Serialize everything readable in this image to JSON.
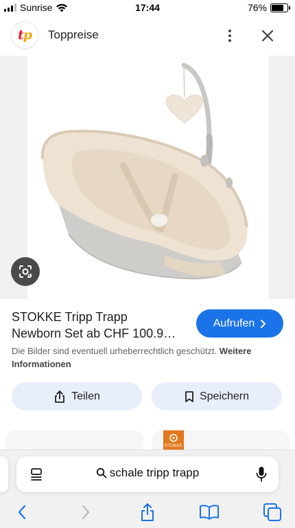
{
  "status_bar": {
    "carrier": "Sunrise",
    "time": "17:44",
    "battery_percent": "76%",
    "battery_level": 0.76
  },
  "header": {
    "logo_text_i": "t",
    "logo_text_p": "p",
    "site_name": "Toppreise"
  },
  "product": {
    "title_line1": "STOKKE Tripp Trapp",
    "title_line2": "Newborn Set ab CHF 100.9…",
    "visit_label": "Aufrufen",
    "copyright_text": "Die Bilder sind eventuell urheberrechtlich geschützt.",
    "copyright_link": "Weitere Informationen"
  },
  "actions": {
    "share_label": "Teilen",
    "save_label": "Speichern"
  },
  "cards": {
    "right_logo_text": "STOKKE"
  },
  "browser": {
    "search_query": "schale tripp trapp"
  },
  "colors": {
    "accent": "#1a73e8",
    "chip_bg": "#e8eefa",
    "logo_red": "#e0222a",
    "logo_yellow": "#f5a400"
  }
}
